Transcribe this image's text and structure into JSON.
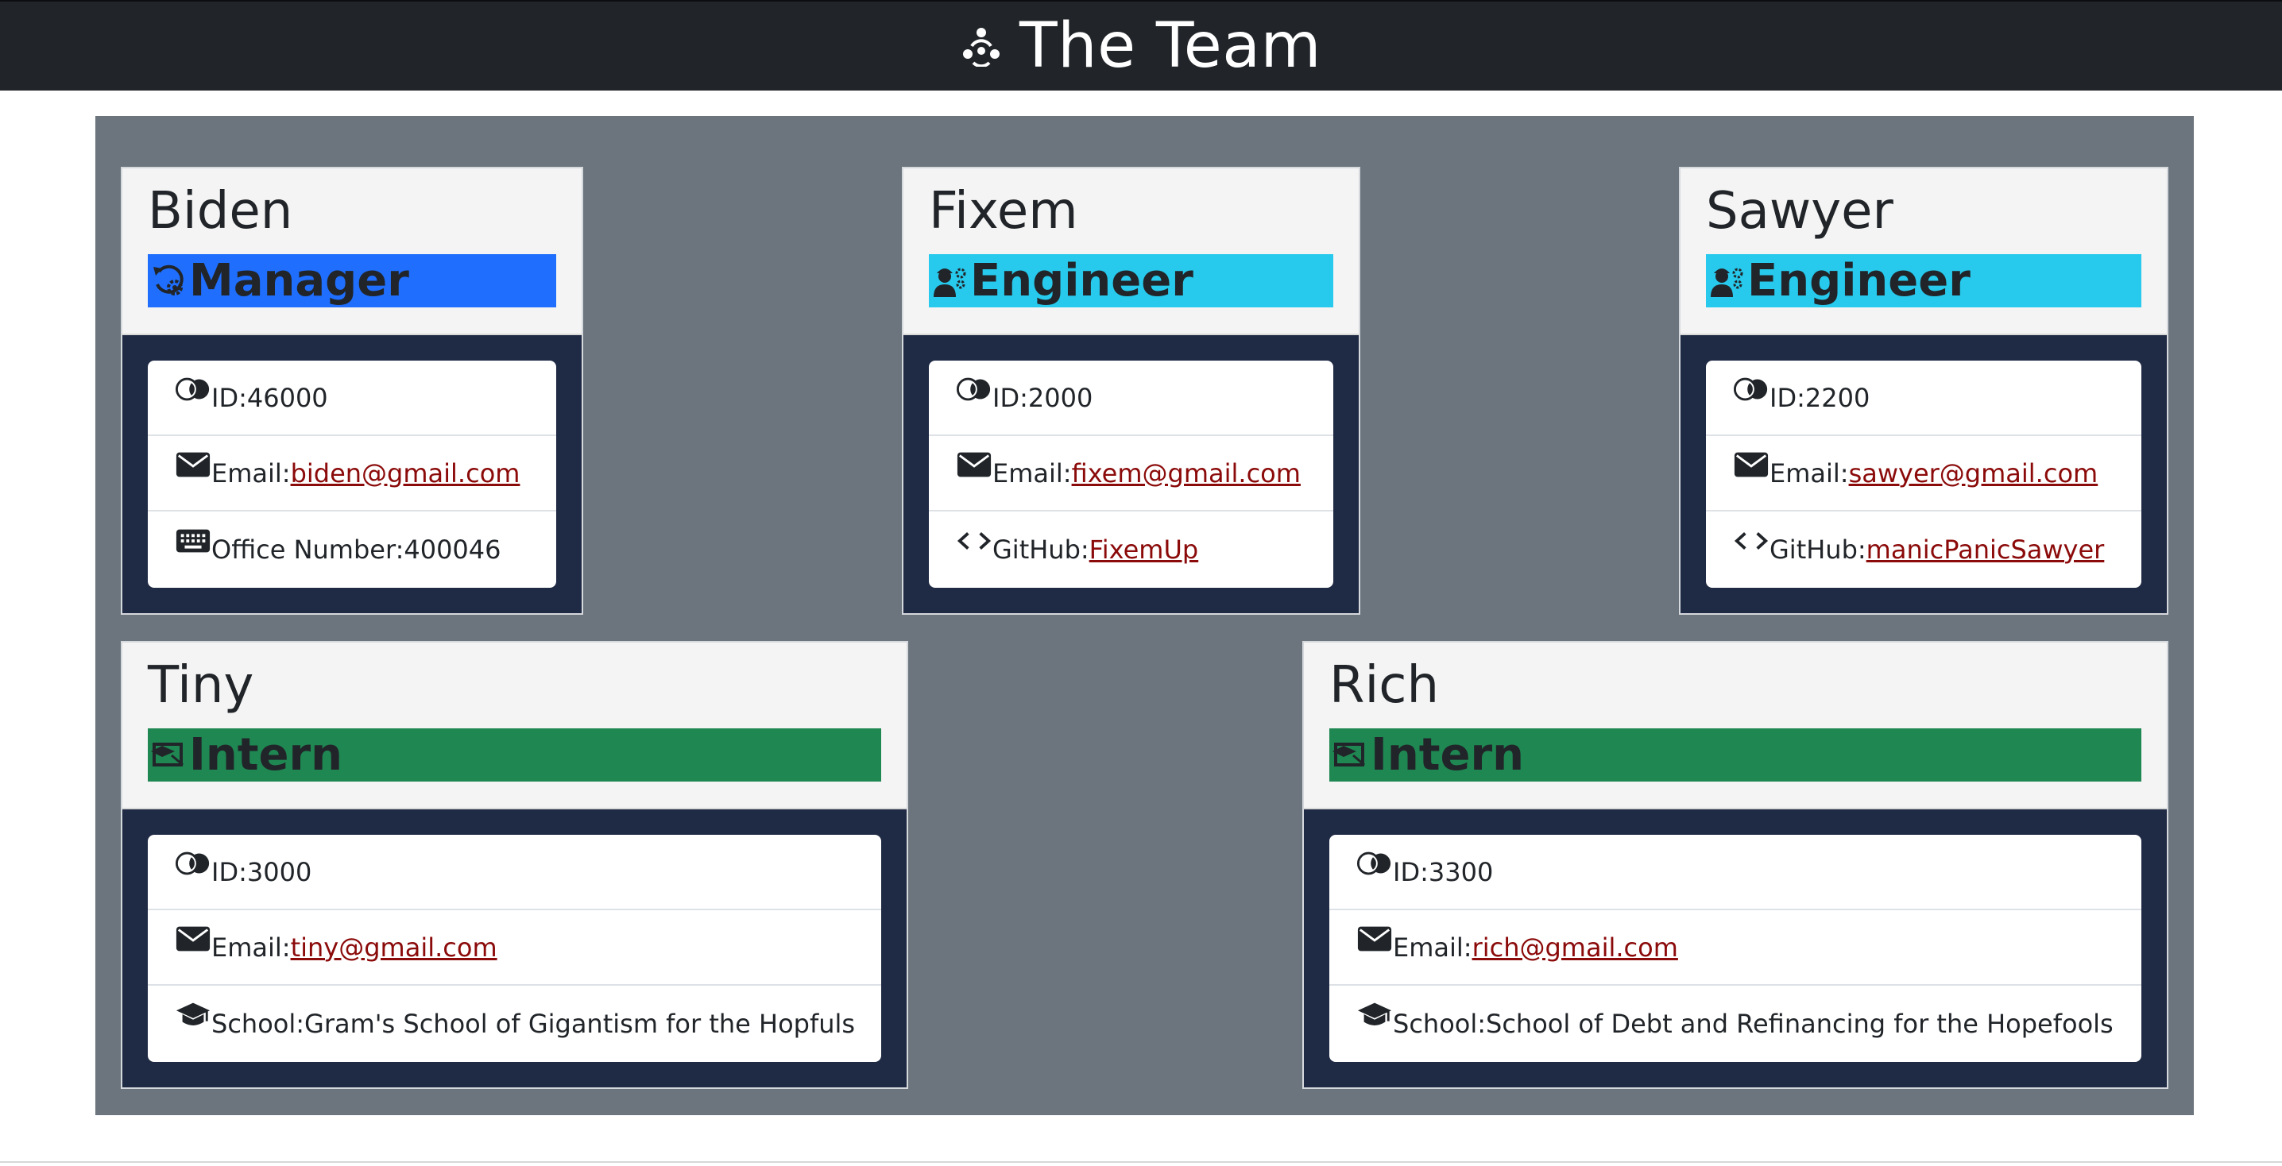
{
  "header": {
    "title": "The Team",
    "logo_icon": "people-group-icon"
  },
  "colors": {
    "header_bg": "#212529",
    "panel_bg": "#6c757d",
    "card_body_bg": "#1f2a44",
    "manager": "#1f6efd",
    "engineer": "#27c9ec",
    "intern": "#1f8752",
    "link": "#8b0a0a"
  },
  "team": [
    {
      "name": "Biden",
      "role": "Manager",
      "role_icon": "manager-cog-icon",
      "id_label": "ID: ",
      "id": "46000",
      "email_label": "Email: ",
      "email": "biden@gmail.com",
      "extra_label": "Office Number: ",
      "extra": "400046",
      "extra_icon": "keyboard-icon"
    },
    {
      "name": "Fixem",
      "role": "Engineer",
      "role_icon": "engineer-icon",
      "id_label": "ID: ",
      "id": "2000",
      "email_label": "Email: ",
      "email": "fixem@gmail.com",
      "extra_label": "GitHub: ",
      "extra": "FixemUp",
      "extra_icon": "code-icon"
    },
    {
      "name": "Sawyer",
      "role": "Engineer",
      "role_icon": "engineer-icon",
      "id_label": "ID: ",
      "id": "2200",
      "email_label": "Email: ",
      "email": "sawyer@gmail.com",
      "extra_label": "GitHub: ",
      "extra": "manicPanicSawyer",
      "extra_icon": "code-icon"
    },
    {
      "name": "Tiny",
      "role": "Intern",
      "role_icon": "intern-icon",
      "id_label": "ID: ",
      "id": "3000",
      "email_label": "Email: ",
      "email": "tiny@gmail.com",
      "extra_label": "School: ",
      "extra": "Gram's School of Gigantism for the Hopfuls",
      "extra_icon": "graduation-cap-icon"
    },
    {
      "name": "Rich",
      "role": "Intern",
      "role_icon": "intern-icon",
      "id_label": "ID: ",
      "id": "3300",
      "email_label": "Email: ",
      "email": "rich@gmail.com",
      "extra_label": "School: ",
      "extra": "School of Debt and Refinancing for the Hopefools",
      "extra_icon": "graduation-cap-icon"
    }
  ]
}
